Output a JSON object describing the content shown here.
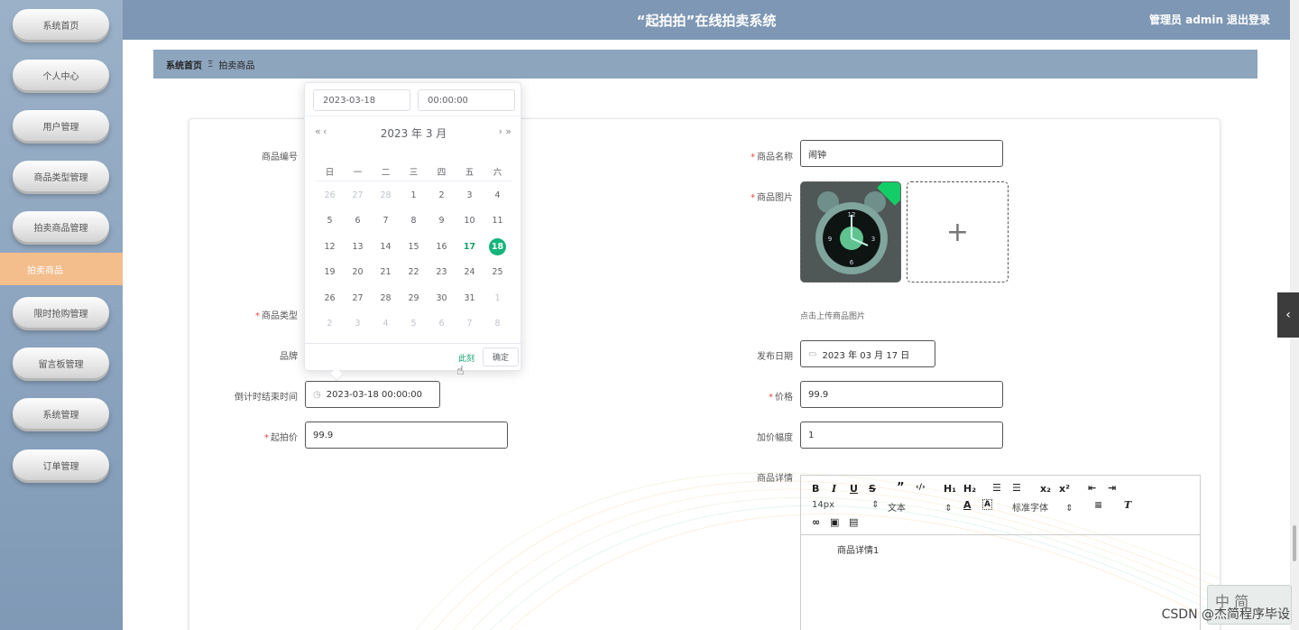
{
  "header": {
    "title": "“起拍拍”在线拍卖系统",
    "user": "管理员 admin",
    "logout": "退出登录"
  },
  "sidebar": {
    "items": [
      "系统首页",
      "个人中心",
      "用户管理",
      "商品类型管理",
      "拍卖商品管理"
    ],
    "active": "拍卖商品",
    "items_after": [
      "限时抢购管理",
      "留言板管理",
      "系统管理",
      "订单管理"
    ]
  },
  "breadcrumb": {
    "home": "系统首页",
    "sep": "Ξ",
    "current": "拍卖商品"
  },
  "form": {
    "product_code_label": "商品编号",
    "product_type_label": "商品类型",
    "brand_label": "品牌",
    "countdown_label": "倒计时结束时间",
    "countdown_value": "2023-03-18 00:00:00",
    "start_price_label": "起拍价",
    "start_price_value": "99.9",
    "product_name_label": "商品名称",
    "product_name_value": "闹钟",
    "product_image_label": "商品图片",
    "upload_hint": "点击上传商品图片",
    "publish_date_label": "发布日期",
    "publish_date_value": "2023 年 03 月 17 日",
    "price_label": "价格",
    "price_value": "99.9",
    "increment_label": "加价幅度",
    "increment_value": "1",
    "detail_label": "商品详情",
    "detail_value": "商品详情1"
  },
  "editor": {
    "font_size": "14px",
    "paragraph": "文本",
    "font_family": "标准字体"
  },
  "picker": {
    "date_input": "2023-03-18",
    "time_input": "00:00:00",
    "header": "2023 年  3 月",
    "weekdays": [
      "日",
      "一",
      "二",
      "三",
      "四",
      "五",
      "六"
    ],
    "weeks": [
      [
        "26",
        "27",
        "28",
        "1",
        "2",
        "3",
        "4"
      ],
      [
        "5",
        "6",
        "7",
        "8",
        "9",
        "10",
        "11"
      ],
      [
        "12",
        "13",
        "14",
        "15",
        "16",
        "17",
        "18"
      ],
      [
        "19",
        "20",
        "21",
        "22",
        "23",
        "24",
        "25"
      ],
      [
        "26",
        "27",
        "28",
        "29",
        "30",
        "31",
        "1"
      ],
      [
        "2",
        "3",
        "4",
        "5",
        "6",
        "7",
        "8"
      ]
    ],
    "today": "17",
    "selected": "18",
    "now_label": "此刻",
    "ok_label": "确定"
  },
  "watermark": "CSDN @杰简程序毕设",
  "ime": "中 简",
  "colors": {
    "accent": "#13b57a",
    "sidebar_active": "#f3bd8c",
    "header": "#7d97b4"
  }
}
